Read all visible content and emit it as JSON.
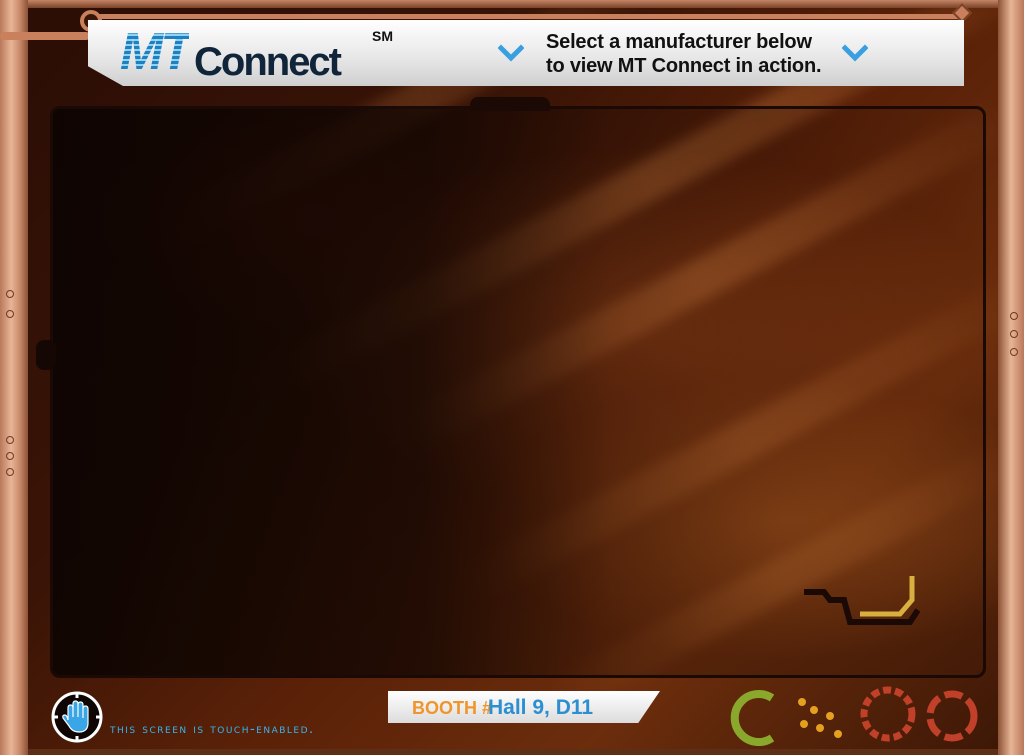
{
  "header": {
    "logo_mt": "MT",
    "logo_connect": "Connect",
    "logo_sm": "SM",
    "instruction_line1": "Select a manufacturer below",
    "instruction_line2": "to view MT Connect in action."
  },
  "footer": {
    "touch_text": "This screen is touch-enabled.",
    "booth_label": "BOOTH #",
    "booth_value": "Hall 9, D11"
  },
  "icons": {
    "chevron_left": "chevron-down-icon",
    "chevron_right": "chevron-down-icon",
    "touch": "hand-touch-icon"
  },
  "colors": {
    "accent_blue": "#2b8fd1",
    "accent_orange": "#f0952b",
    "frame_copper": "#c9805c"
  }
}
